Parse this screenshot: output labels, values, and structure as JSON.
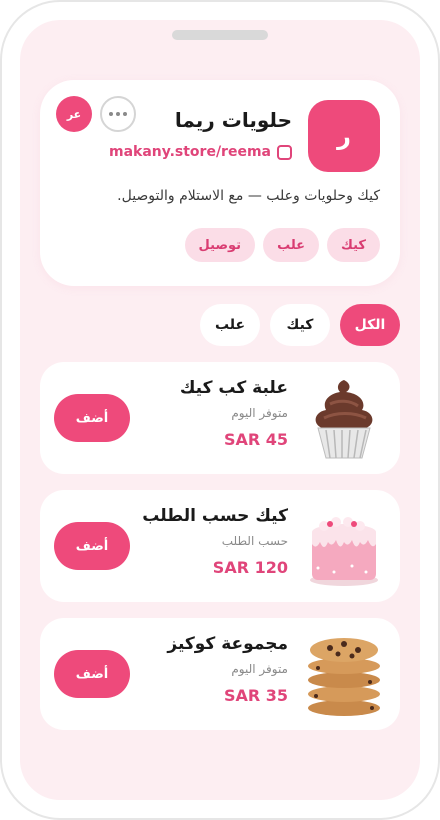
{
  "store": {
    "logo_letter": "ر",
    "name": "حلويات ريما",
    "link": "makany.store/reema",
    "description": "كيك وحلويات وعلب — مع الاستلام والتوصيل.",
    "lang_label": "عر",
    "tags": [
      "كيك",
      "علب",
      "توصيل"
    ]
  },
  "filters": [
    {
      "label": "الكل",
      "active": true
    },
    {
      "label": "كيك",
      "active": false
    },
    {
      "label": "علب",
      "active": false
    }
  ],
  "products": [
    {
      "name": "علبة كب كيك",
      "status": "متوفر اليوم",
      "price": "SAR 45",
      "add_label": "أضف",
      "image": "cupcake"
    },
    {
      "name": "كيك حسب الطلب",
      "status": "حسب الطلب",
      "price": "SAR 120",
      "add_label": "أضف",
      "image": "drip-cake"
    },
    {
      "name": "مجموعة كوكيز",
      "status": "متوفر اليوم",
      "price": "SAR 35",
      "add_label": "أضف",
      "image": "cookie-stack"
    }
  ],
  "colors": {
    "accent": "#ee4a7b",
    "accent_text": "#e0457a",
    "screen_bg": "#fdeef2",
    "tag_bg": "#fbdde7"
  }
}
